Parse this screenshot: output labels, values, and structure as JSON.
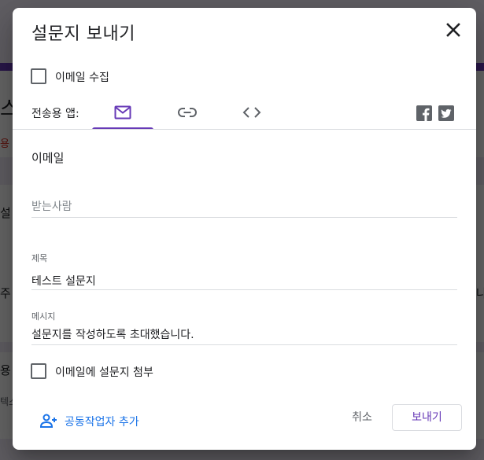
{
  "dialog": {
    "title": "설문지 보내기",
    "collect_email_label": "이메일 수집",
    "send_via_label": "전송용 앱:",
    "tabs": [
      {
        "icon": "mail-icon",
        "active": true
      },
      {
        "icon": "link-icon",
        "active": false
      },
      {
        "icon": "embed-code-icon",
        "active": false
      }
    ],
    "social": [
      "facebook-icon",
      "twitter-icon"
    ],
    "section_title": "이메일",
    "to": {
      "placeholder": "받는사람",
      "value": ""
    },
    "subject": {
      "label": "제목",
      "value": "테스트 설문지"
    },
    "message": {
      "label": "메시지",
      "value": "설문지를 작성하도록 초대했습니다."
    },
    "include_form_label": "이메일에 설문지 첨부",
    "add_collaborators_label": "공동작업자 추가",
    "cancel_label": "취소",
    "send_label": "보내기"
  },
  "background": {
    "fragments": [
      "스",
      "용 ",
      "설",
      "주",
      "나",
      "용",
      "텍스"
    ]
  },
  "colors": {
    "accent": "#673ab7",
    "link": "#1a73e8",
    "text": "#202124",
    "muted": "#5f6368"
  }
}
